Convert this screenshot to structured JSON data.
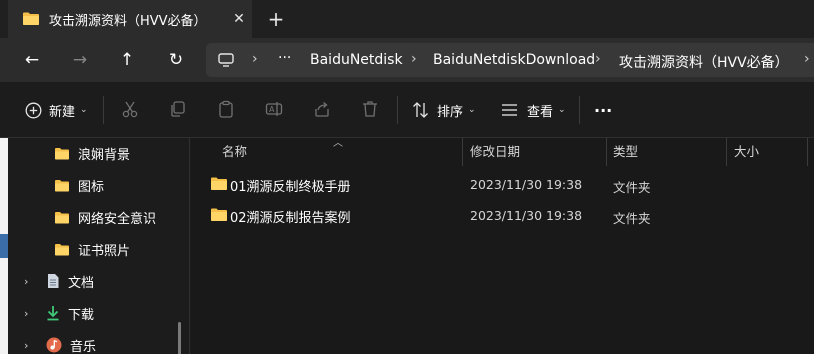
{
  "tab": {
    "title": "攻击溯源资料（HVV必备）",
    "close_label": "✕",
    "new_tab_label": "+"
  },
  "nav": {
    "back": "←",
    "forward": "→",
    "up": "↑",
    "refresh": "↻",
    "more_crumbs": "···",
    "breadcrumbs": [
      "BaiduNetdisk",
      "BaiduNetdiskDownload",
      "攻击溯源资料（HVV必备）"
    ],
    "sep": "›"
  },
  "toolbar": {
    "new_label": "新建",
    "sort_label": "排序",
    "view_label": "查看",
    "more_label": "···"
  },
  "sidebar": {
    "items": [
      {
        "label": "浪娴背景",
        "icon": "folder-icon"
      },
      {
        "label": "图标",
        "icon": "folder-icon"
      },
      {
        "label": "网络安全意识",
        "icon": "folder-icon"
      },
      {
        "label": "证书照片",
        "icon": "folder-icon"
      },
      {
        "label": "文档",
        "icon": "document-icon"
      },
      {
        "label": "下载",
        "icon": "download-icon"
      },
      {
        "label": "音乐",
        "icon": "music-icon"
      }
    ]
  },
  "columns": {
    "name": "名称",
    "modified": "修改日期",
    "type": "类型",
    "size": "大小"
  },
  "files": [
    {
      "name": "01溯源反制终极手册",
      "modified": "2023/11/30 19:38",
      "type": "文件夹"
    },
    {
      "name": "02溯源反制报告案例",
      "modified": "2023/11/30 19:38",
      "type": "文件夹"
    }
  ],
  "colors": {
    "folder": "#f4c04a",
    "accent": "#4cc2ff",
    "download": "#3fc978"
  }
}
